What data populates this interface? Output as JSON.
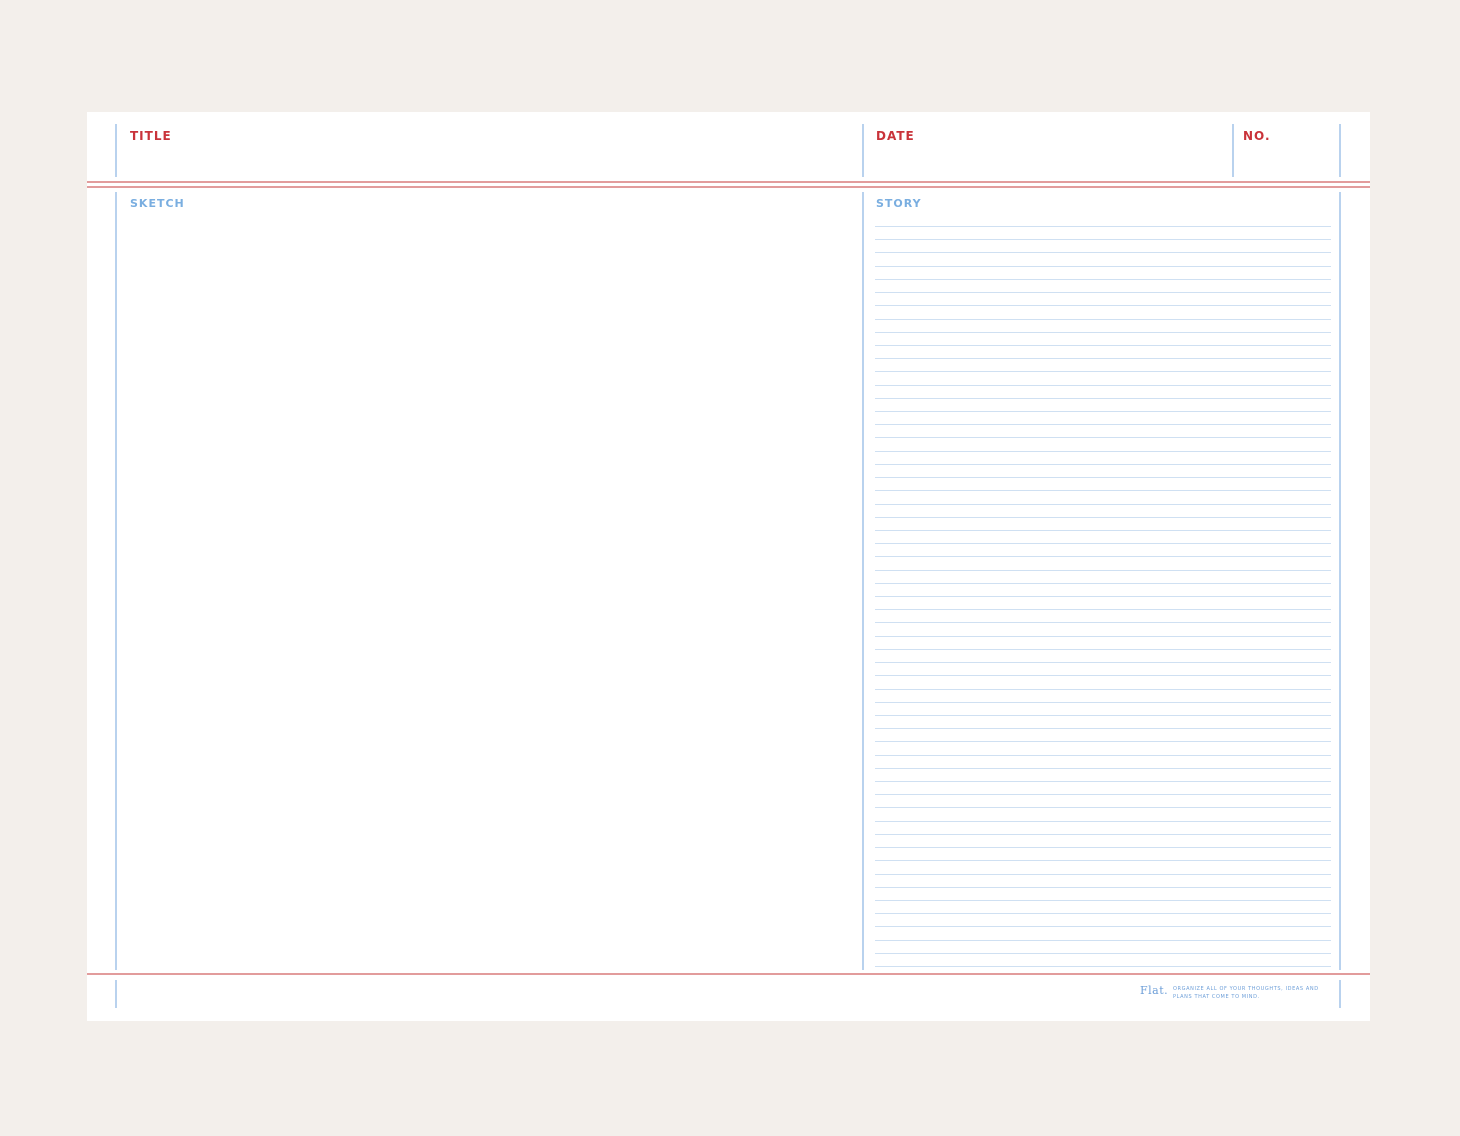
{
  "header": {
    "title_label": "TITLE",
    "date_label": "DATE",
    "number_label": "NO."
  },
  "body": {
    "sketch_label": "SKETCH",
    "story_label": "STORY",
    "story_line_count": 57
  },
  "footer": {
    "brand": "Flat.",
    "tagline": "Organize all of your thoughts, ideas and plans that come to mind."
  },
  "colors": {
    "background": "#f3efeb",
    "sheet": "#ffffff",
    "accent_red": "#c9333a",
    "rule_red": "#e29c9c",
    "accent_blue": "#7aaee0",
    "rule_blue": "#b9d2ee"
  }
}
